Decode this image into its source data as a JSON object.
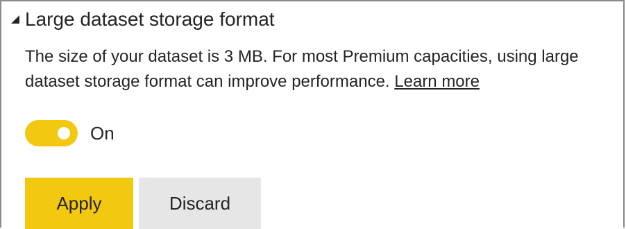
{
  "section": {
    "title": "Large dataset storage format",
    "collapse_icon": "caret-down-left-icon",
    "description": "The size of your dataset is 3 MB. For most Premium capacities, using large dataset storage format can improve performance.",
    "learn_more_label": "Learn more"
  },
  "toggle": {
    "state": "on",
    "label": "On",
    "color": "#f2c811"
  },
  "actions": {
    "apply_label": "Apply",
    "discard_label": "Discard",
    "apply_color": "#f2c811",
    "discard_color": "#e6e6e6"
  }
}
